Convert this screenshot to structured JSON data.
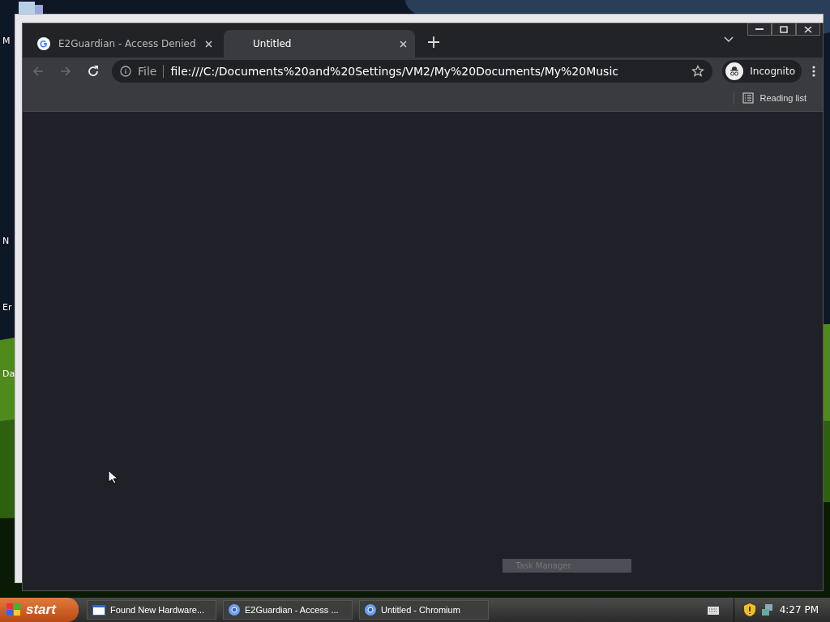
{
  "desktop": {
    "icon_labels": [
      {
        "text": "M"
      },
      {
        "text": "N"
      },
      {
        "text": "Er"
      },
      {
        "text": "Da"
      }
    ]
  },
  "browser": {
    "tabs": [
      {
        "title": "E2Guardian - Access Denied",
        "selected": false,
        "kind": "google"
      },
      {
        "title": "Untitled",
        "selected": true,
        "kind": "blank"
      }
    ],
    "nav": {
      "back_disabled": true,
      "forward_disabled": true
    },
    "address": {
      "scheme": "File",
      "url": "file:///C:/Documents%20and%20Settings/VM2/My%20Documents/My%20Music"
    },
    "profile": "Incognito",
    "reading_list": "Reading list"
  },
  "popup": {
    "label": "Task Manager"
  },
  "taskbar": {
    "start": "start",
    "items": [
      {
        "label": "Found New Hardware...",
        "kind": "window"
      },
      {
        "label": "E2Guardian - Access ...",
        "kind": "chromium"
      },
      {
        "label": "Untitled - Chromium",
        "kind": "chromium"
      }
    ],
    "clock": "4:27 PM"
  }
}
